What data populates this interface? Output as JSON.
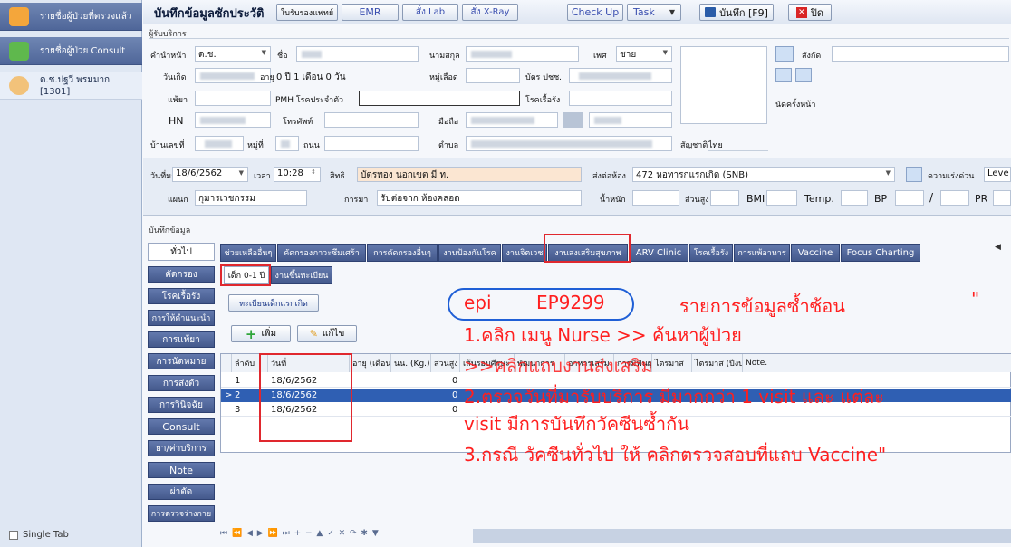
{
  "sidebar": {
    "items": [
      {
        "label": "รายชื่อผู้ป่วยที่ตรวจแล้ว",
        "icon": "user-icon"
      },
      {
        "label": "รายชื่อผู้ป่วย Consult",
        "icon": "users-add-icon"
      },
      {
        "label": "ด.ช.ปฐวี พรมมาก [1301]",
        "icon": "child-avatar-icon"
      }
    ],
    "single_tab_label": "Single Tab"
  },
  "header": {
    "title": "บันทึกข้อมูลซักประวัติ",
    "buttons": [
      "ใบรับรองแพทย์",
      "EMR",
      "สั่ง Lab",
      "สั่ง X-Ray",
      "Check Up",
      "Task"
    ],
    "save_label": "บันทึก [F9]",
    "close_label": "ปิด"
  },
  "patient": {
    "section_label": "ผู้รับบริการ",
    "prefix_label": "คำนำหน้า",
    "prefix_value": "ด.ช.",
    "name_label": "ชื่อ",
    "surname_label": "นามสกุล",
    "gender_label": "เพศ",
    "gender_value": "ชาย",
    "birthdate_label": "วันเกิด",
    "age_label": "อายุ",
    "age_value": "0 ปี 1 เดือน 0 วัน",
    "blood_label": "หมู่เลือด",
    "idcard_label": "บัตร ปชช.",
    "allergy_label": "แพ้ยา",
    "pmh_label": "PMH โรคประจำตัว",
    "chronic_label": "โรคเรื้อรัง",
    "hn_label": "HN",
    "phone_label": "โทรศัพท์",
    "mobile_label": "มือถือ",
    "address_label": "บ้านเลขที่",
    "moo_label": "หมู่ที่",
    "road_label": "ถนน",
    "tambon_label": "ตำบล",
    "nationality_label": "สัญชาติ",
    "nationality_value": "ไทย",
    "affiliation_label": "สังกัด",
    "appointment_label": "นัดครั้งหน้า"
  },
  "visit": {
    "date_label": "วันที่มา",
    "date_value": "18/6/2562",
    "time_label": "เวลา",
    "time_value": "10:28",
    "right_label": "สิทธิ",
    "right_value": "บัตรทอง นอกเขต มี ท.",
    "send_label": "ส่งต่อห้อง",
    "send_value": "472 หอทารกแรกเกิด (SNB)",
    "urgency_label": "ความเร่งด่วน",
    "urgency_value": "Leve",
    "dept_label": "แผนก",
    "dept_value": "กุมารเวชกรรม",
    "mode_label": "การมา",
    "mode_value": "รับต่อจาก ห้องคลอด",
    "weight_label": "น้ำหนัก",
    "height_label": "ส่วนสูง",
    "bmi_label": "BMI",
    "temp_label": "Temp.",
    "bp_label": "BP",
    "bp_sep": "/",
    "pr_label": "PR"
  },
  "record": {
    "section_label": "บันทึกข้อมูล",
    "top_tabs": [
      "ทั่วไป",
      "ช่วยเหลืออื่นๆ",
      "คัดกรองภาวะซึมเศร้า",
      "การคัดกรองอื่นๆ",
      "งานป้องกันโรค",
      "งานจิตเวช",
      "งานส่งเสริมสุขภาพ",
      "ARV Clinic",
      "โรคเรื้อรัง",
      "การแพ้อาหาร",
      "Vaccine",
      "Focus Charting"
    ],
    "side_tabs": [
      "คัดกรอง",
      "โรคเรื้อรัง",
      "การให้คำแนะนำ",
      "การแพ้ยา",
      "การนัดหมาย",
      "การส่งตัว",
      "การวินิจฉัย",
      "Consult",
      "ยา/ค่าบริการ",
      "Note",
      "ผ่าตัด",
      "การตรวจร่างกาย"
    ],
    "sub_tabs": [
      "เด็ก 0-1 ปี",
      "งานขึ้นทะเบียน"
    ],
    "register_btn": "ทะเบียนเด็กแรกเกิด",
    "add_btn": "เพิ่ม",
    "edit_btn": "แก้ไข"
  },
  "grid": {
    "columns": [
      "ลำดับ",
      "วันที่",
      "อายุ (เดือน)",
      "นน. (Kg.)",
      "ส่วนสูง (c",
      "เส้นรอบศีรษะ",
      "พัฒนาการ",
      "อาหารเสริม",
      "การมีฟันผุ",
      "ไตรมาส",
      "ไตรมาส (ปีงบ)",
      "Note."
    ],
    "rows": [
      {
        "no": "1",
        "date": "18/6/2562",
        "weight": "0"
      },
      {
        "no": "2",
        "date": "18/6/2562",
        "weight": "0"
      },
      {
        "no": "3",
        "date": "18/6/2562",
        "weight": "0"
      }
    ],
    "navigator": "⏮ ⏪ ◀ ▶ ⏩ ⏭ + − ▲ ✓ ✕ ↷ ✱ ▼"
  },
  "annotation": {
    "code_a": "epi",
    "code_b": "EP9299",
    "title": "รายการข้อมูลซ้ำซ้อน",
    "quote": "\"",
    "line1": "1.คลิก เมนู Nurse >> ค้นหาผู้ป่วย",
    "line2": ">>คลิกแถบงานส่งเสริม",
    "line3": "2.ตรวจวันที่มารับบริการ มีมากกว่า 1 visit  และ แต่ละ",
    "line4": "visit มีการบันทึกวัคซีนซ้ำกัน",
    "line5": "3.กรณี วัคซีนทั่วไป ให้ คลิกตรวจสอบที่แถบ Vaccine\""
  },
  "colors": {
    "accent_red": "#e0282e",
    "annotation_blue": "#1f5fd6",
    "selected_row": "#2f5fb3",
    "tab_blue": "#4f6699"
  }
}
